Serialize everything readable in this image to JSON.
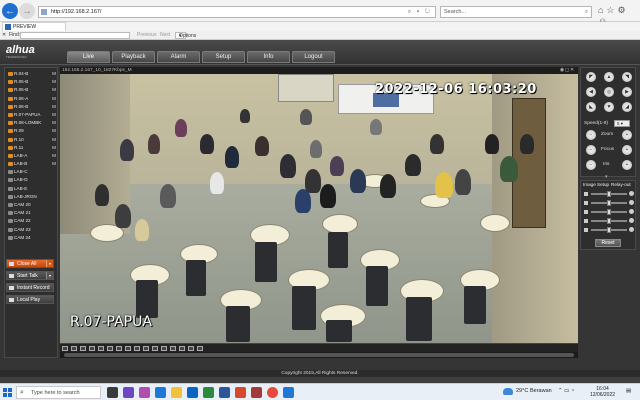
{
  "browser": {
    "url": "http://192.168.2.167/",
    "search_placeholder": "Search...",
    "tab_title": "PREVIEW",
    "find_label": "Find:",
    "find_previous": "Previous",
    "find_next": "Next",
    "options_label": "Options"
  },
  "app": {
    "logo": "alhua",
    "logo_sub": "TECHNOLOGY",
    "nav_tabs": [
      "Live",
      "Playback",
      "Alarm",
      "Setup",
      "Info",
      "Logout"
    ],
    "active_tab": "Live"
  },
  "channels": [
    {
      "name": "R.04-B",
      "flag": "M",
      "active": true
    },
    {
      "name": "R.05-B",
      "flag": "M",
      "active": true
    },
    {
      "name": "R.05-B",
      "flag": "M",
      "active": true
    },
    {
      "name": "R.06-A",
      "flag": "M",
      "active": true
    },
    {
      "name": "R.06-B",
      "flag": "M",
      "active": true
    },
    {
      "name": "R.07-PAPUA",
      "flag": "M",
      "active": true
    },
    {
      "name": "R.08-LOMBK",
      "flag": "M",
      "active": true
    },
    {
      "name": "R.09",
      "flag": "M",
      "active": true
    },
    {
      "name": "R.10",
      "flag": "M",
      "active": true
    },
    {
      "name": "R.11",
      "flag": "M",
      "active": true
    },
    {
      "name": "LAB-A",
      "flag": "M",
      "active": true
    },
    {
      "name": "LAB-B",
      "flag": "M",
      "active": true
    },
    {
      "name": "LAB-C",
      "flag": "",
      "active": false
    },
    {
      "name": "LAB-D",
      "flag": "",
      "active": false
    },
    {
      "name": "LAB-E",
      "flag": "",
      "active": false
    },
    {
      "name": "LAB-JRGN",
      "flag": "",
      "active": false
    },
    {
      "name": "CAM 20",
      "flag": "",
      "active": false
    },
    {
      "name": "CAM 21",
      "flag": "",
      "active": false
    },
    {
      "name": "CAM 22",
      "flag": "",
      "active": false
    },
    {
      "name": "CAM 23",
      "flag": "",
      "active": false
    },
    {
      "name": "CAM 24",
      "flag": "",
      "active": false
    }
  ],
  "sidebar_buttons": {
    "close_all": "Close All",
    "start_talk": "Start Talk",
    "instant_record": "Instant Record",
    "local_play": "Local Play"
  },
  "video": {
    "info_bar": "192.168.2.167_10_1827Kbps_M",
    "osd_timestamp": "2022-12-06 16:03:20",
    "osd_channel": "R.07-PAPUA"
  },
  "ptz": {
    "speed_label": "Speed(1-8)",
    "speed_value": "5",
    "zoom_label": "Zoom",
    "focus_label": "Focus",
    "iris_label": "Iris"
  },
  "image_setup": {
    "tab1": "Image Setup",
    "tab2": "Relay-out",
    "slider_levels": [
      0.5,
      0.5,
      0.5,
      0.5,
      0.5
    ],
    "reset_label": "Reset"
  },
  "footer": {
    "copyright": "Copyright 2015,All Rights Reserved."
  },
  "taskbar": {
    "search_placeholder": "Type here to search",
    "weather_temp": "29°C",
    "weather_desc": "Berawan",
    "time": "16:04",
    "date": "12/06/2022"
  },
  "colors": {
    "accent_orange": "#e38d1e",
    "close_all_bg": "#d45a1c",
    "header_bg": "#3d3d3d"
  }
}
